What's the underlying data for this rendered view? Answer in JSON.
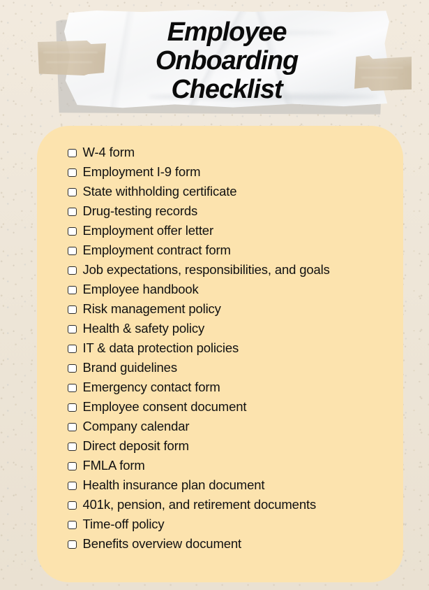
{
  "colors": {
    "page_background": "#f0e8db",
    "card_background": "#fce3ae",
    "banner_paper": "#f7f8f9",
    "tape": "#cdbda3",
    "text": "#111111",
    "checkbox_border": "#2b2b2b",
    "checkbox_fill": "#ffffff"
  },
  "header": {
    "title": "Employee\nOnboarding\nChecklist",
    "title_lines": [
      "Employee",
      "Onboarding",
      "Checklist"
    ],
    "tape_left_label": "tape",
    "tape_right_label": "tape"
  },
  "checklist": {
    "items": [
      {
        "label": "W-4 form",
        "checked": false
      },
      {
        "label": "Employment I-9 form",
        "checked": false
      },
      {
        "label": "State withholding certificate",
        "checked": false
      },
      {
        "label": "Drug-testing records",
        "checked": false
      },
      {
        "label": "Employment offer letter",
        "checked": false
      },
      {
        "label": "Employment contract form",
        "checked": false
      },
      {
        "label": "Job expectations, responsibilities, and goals",
        "checked": false
      },
      {
        "label": "Employee handbook",
        "checked": false
      },
      {
        "label": "Risk management policy",
        "checked": false
      },
      {
        "label": "Health & safety policy",
        "checked": false
      },
      {
        "label": "IT & data protection policies",
        "checked": false
      },
      {
        "label": "Brand guidelines",
        "checked": false
      },
      {
        "label": "Emergency contact form",
        "checked": false
      },
      {
        "label": "Employee consent document",
        "checked": false
      },
      {
        "label": "Company calendar",
        "checked": false
      },
      {
        "label": "Direct deposit form",
        "checked": false
      },
      {
        "label": "FMLA form",
        "checked": false
      },
      {
        "label": "Health insurance plan document",
        "checked": false
      },
      {
        "label": "401k, pension, and retirement documents",
        "checked": false
      },
      {
        "label": "Time-off policy",
        "checked": false
      },
      {
        "label": "Benefits overview document",
        "checked": false
      }
    ]
  }
}
